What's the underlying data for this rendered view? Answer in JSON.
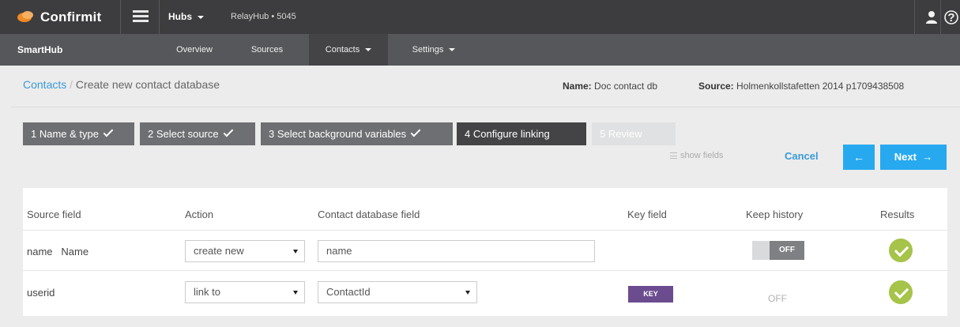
{
  "app": {
    "logo_text": "Confirmit",
    "hubs_label": "Hubs",
    "hub_name": "RelayHub • 5045",
    "icons": [
      "menu-icon",
      "user-icon",
      "help-icon"
    ]
  },
  "nav": {
    "brand": "SmartHub",
    "items": [
      {
        "label": "Overview",
        "dropdown": false
      },
      {
        "label": "Sources",
        "dropdown": false
      },
      {
        "label": "Contacts",
        "dropdown": true
      },
      {
        "label": "Settings",
        "dropdown": true
      }
    ],
    "active": "Contacts"
  },
  "breadcrumb": {
    "link": "Contacts",
    "separator": " / ",
    "current": "Create new contact database"
  },
  "meta": {
    "name_label": "Name:",
    "name_value": "Doc contact db",
    "source_label": "Source:",
    "source_value": "Holmenkollstafetten 2014 p1709438508"
  },
  "steps": [
    {
      "label": "1 Name & type",
      "state": "done"
    },
    {
      "label": "2 Select source",
      "state": "done"
    },
    {
      "label": "3 Select background variables",
      "state": "done"
    },
    {
      "label": "4 Configure linking",
      "state": "current"
    },
    {
      "label": "5 Review",
      "state": "future"
    }
  ],
  "actions": {
    "show_fields": "show fields",
    "cancel": "Cancel",
    "prev_icon": "←",
    "next": "Next",
    "next_icon": "→"
  },
  "table": {
    "headers": [
      "Source field",
      "Action",
      "Contact database field",
      "Key field",
      "Keep history",
      "Results"
    ],
    "rows": [
      {
        "source_field": "name",
        "source_label": "Name",
        "action": "create new",
        "contact_field": "name",
        "contact_field_type": "input",
        "key_field": "",
        "keep_history": "OFF",
        "keep_history_type": "toggle",
        "result": "ok"
      },
      {
        "source_field": "userid",
        "source_label": "",
        "action": "link to",
        "contact_field": "ContactId",
        "contact_field_type": "select",
        "key_field": "KEY",
        "keep_history": "OFF",
        "keep_history_type": "text",
        "result": "ok"
      }
    ]
  },
  "colors": {
    "topbar": "#3d3d3f",
    "navbar": "#56575a",
    "accent": "#27a9f0",
    "link": "#3a9ad9",
    "key_badge": "#6b4c8f",
    "success": "#a6c34a"
  }
}
